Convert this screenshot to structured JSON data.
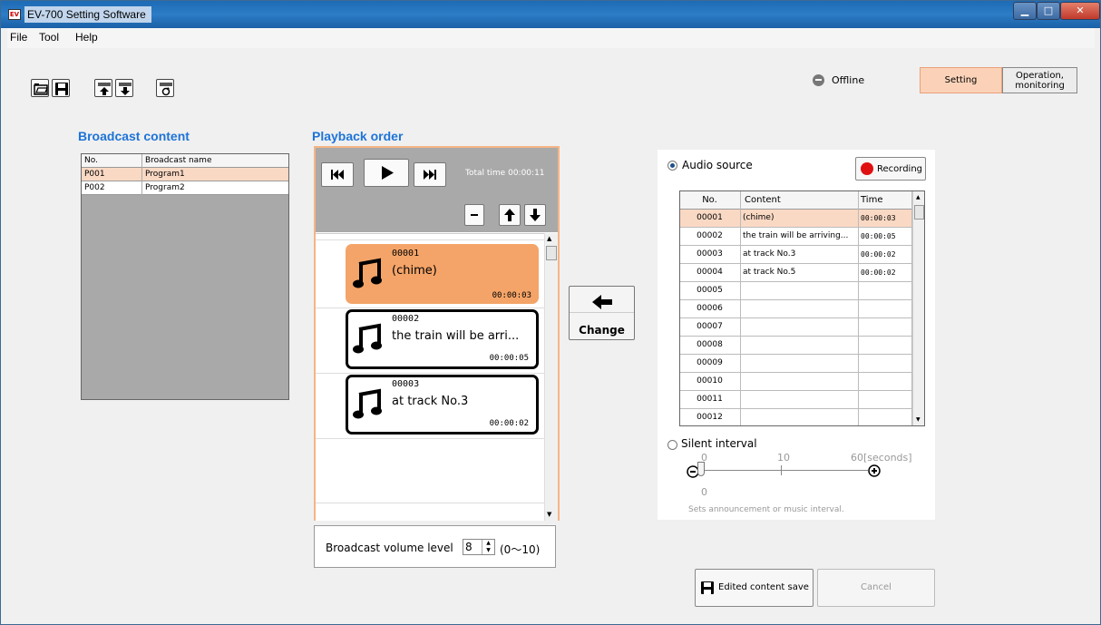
{
  "window": {
    "title": "EV-700 Setting Software",
    "icon_label": "EV"
  },
  "menu": {
    "file": "File",
    "tool": "Tool",
    "help": "Help"
  },
  "toolbar": {
    "icons": [
      "open-folder-icon",
      "save-disk-icon",
      "upload-icon",
      "download-icon",
      "refresh-icon"
    ]
  },
  "status": {
    "label": "Offline"
  },
  "mode": {
    "setting": "Setting",
    "operation": "Operation, monitoring"
  },
  "broadcast": {
    "heading": "Broadcast content",
    "col_no": "No.",
    "col_name": "Broadcast name",
    "rows": [
      {
        "no": "P001",
        "name": "Program1"
      },
      {
        "no": "P002",
        "name": "Program2"
      }
    ]
  },
  "playback": {
    "heading": "Playback order",
    "total_time_label": "Total time",
    "total_time": "00:00:11",
    "items": [
      {
        "no": "00001",
        "content": "(chime)",
        "time": "00:00:03"
      },
      {
        "no": "00002",
        "content": "the train will be arri...",
        "time": "00:00:05"
      },
      {
        "no": "00003",
        "content": "at track No.3",
        "time": "00:00:02"
      }
    ]
  },
  "volume": {
    "label": "Broadcast volume level",
    "value": "8",
    "range": "(0〜10)"
  },
  "change": {
    "label": "Change"
  },
  "audio_source": {
    "label": "Audio source",
    "recording": "Recording",
    "col_no": "No.",
    "col_content": "Content",
    "col_time": "Time",
    "rows": [
      {
        "no": "00001",
        "content": "(chime)",
        "time": "00:00:03"
      },
      {
        "no": "00002",
        "content": "the train will be arriving...",
        "time": "00:00:05"
      },
      {
        "no": "00003",
        "content": "at track No.3",
        "time": "00:00:02"
      },
      {
        "no": "00004",
        "content": "at track No.5",
        "time": "00:00:02"
      },
      {
        "no": "00005",
        "content": "",
        "time": ""
      },
      {
        "no": "00006",
        "content": "",
        "time": ""
      },
      {
        "no": "00007",
        "content": "",
        "time": ""
      },
      {
        "no": "00008",
        "content": "",
        "time": ""
      },
      {
        "no": "00009",
        "content": "",
        "time": ""
      },
      {
        "no": "00010",
        "content": "",
        "time": ""
      },
      {
        "no": "00011",
        "content": "",
        "time": ""
      },
      {
        "no": "00012",
        "content": "",
        "time": ""
      }
    ]
  },
  "silent": {
    "label": "Silent interval",
    "tick_min": "0",
    "tick_mid": "10",
    "tick_max": "60[seconds]",
    "value": "0",
    "hint": "Sets announcement or music interval."
  },
  "actions": {
    "save": "Edited content save",
    "cancel": "Cancel"
  },
  "colors": {
    "accent_blue": "#1e73d8",
    "selected_orange": "#f4a468",
    "selected_row": "#fad9c4",
    "recording_red": "#e01010"
  }
}
